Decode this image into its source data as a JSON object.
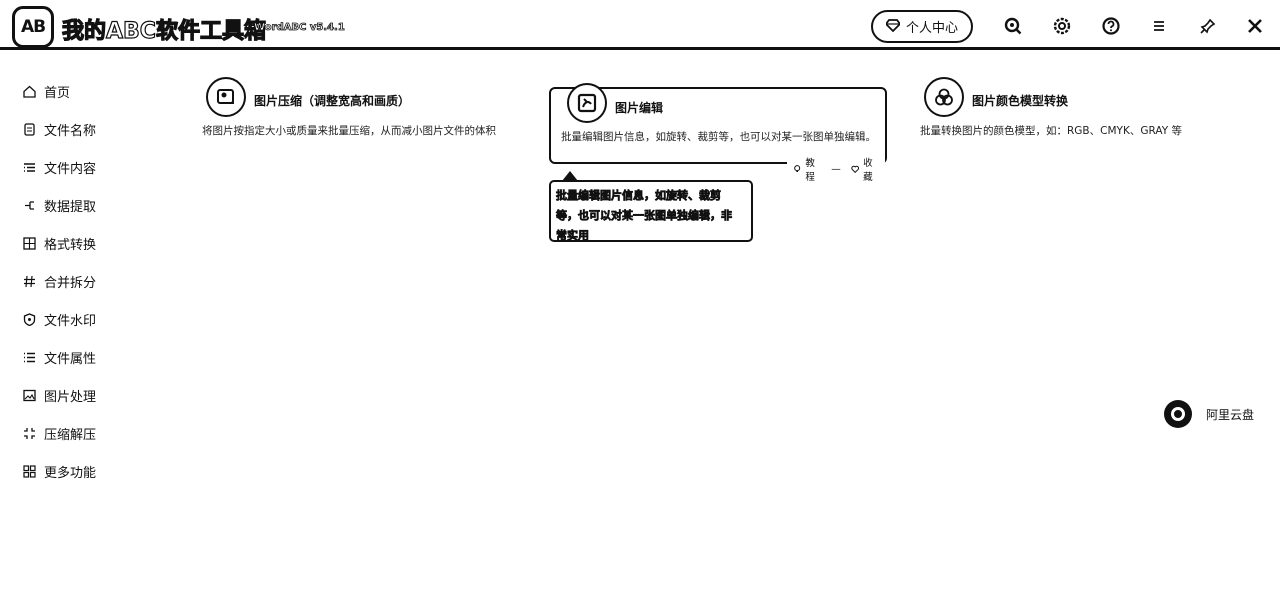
{
  "header": {
    "logo_text": "AB",
    "app_title": "我的ABC软件工具箱",
    "version": "WordABC v5.4.1",
    "user_center_label": "个人中心",
    "icons": [
      "search-icon",
      "settings-icon",
      "help-icon",
      "menu-icon",
      "pin-icon",
      "close-icon"
    ]
  },
  "sidebar": {
    "items": [
      {
        "label": "首页",
        "icon": "home-icon"
      },
      {
        "label": "文件名称",
        "icon": "file-name-icon"
      },
      {
        "label": "文件内容",
        "icon": "file-content-icon"
      },
      {
        "label": "数据提取",
        "icon": "data-extract-icon"
      },
      {
        "label": "格式转换",
        "icon": "format-convert-icon"
      },
      {
        "label": "合并拆分",
        "icon": "merge-split-icon"
      },
      {
        "label": "文件水印",
        "icon": "watermark-icon"
      },
      {
        "label": "文件属性",
        "icon": "file-property-icon"
      },
      {
        "label": "图片处理",
        "icon": "image-process-icon"
      },
      {
        "label": "压缩解压",
        "icon": "compress-icon"
      },
      {
        "label": "更多功能",
        "icon": "more-icon"
      }
    ]
  },
  "cards": [
    {
      "title": "图片压缩（调整宽高和画质）",
      "desc": "将图片按指定大小或质量来批量压缩，从而减小图片文件的体积",
      "icon": "image-compress-icon"
    },
    {
      "title": "图片编辑",
      "desc": "批量编辑图片信息，如旋转、裁剪等，也可以对某一张图单独编辑。",
      "icon": "image-edit-icon"
    },
    {
      "title": "图片颜色模型转换",
      "desc": "批量转换图片的颜色模型，如：RGB、CMYK、GRAY 等",
      "icon": "color-model-icon"
    }
  ],
  "card_actions": {
    "tutorial": "教程",
    "favorite": "收藏"
  },
  "tooltip": {
    "lines": [
      "批量编辑图片信息，如旋转、裁剪",
      "等，也可以对某一张图单独编辑，非",
      "常实用"
    ]
  },
  "aliyun": {
    "label": "阿里云盘"
  }
}
